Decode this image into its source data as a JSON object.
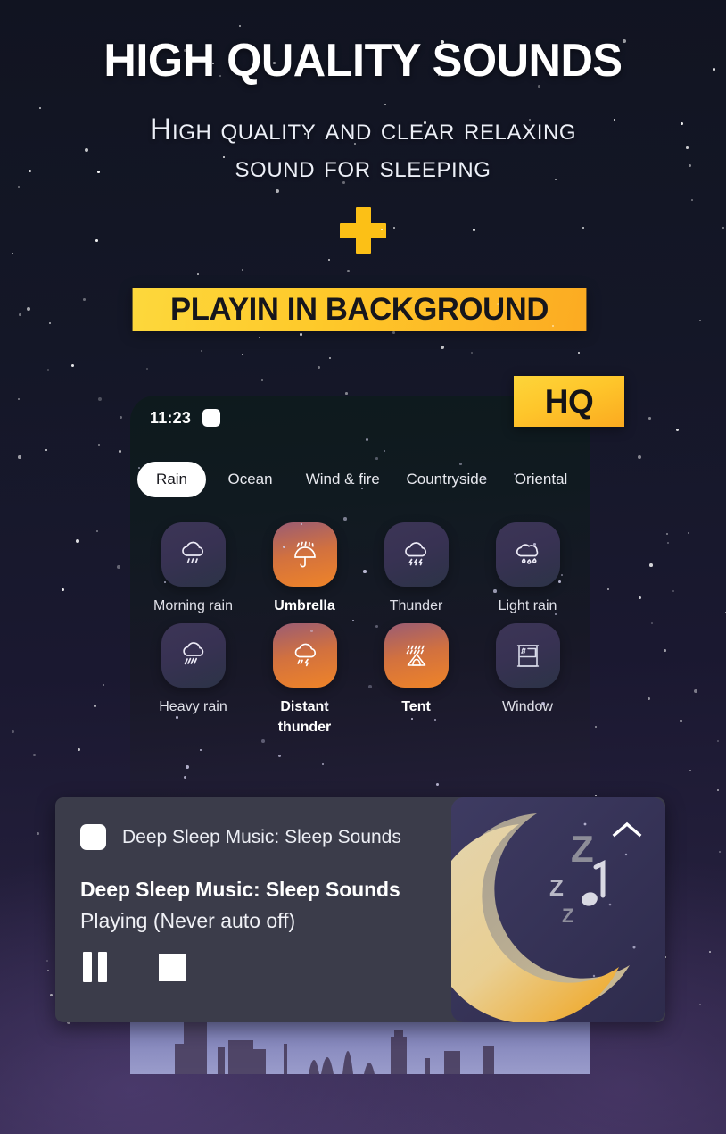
{
  "hero": {
    "title": "HIGH QUALITY SOUNDS",
    "subtitle_line1": "High quality and clear relaxing",
    "subtitle_line2": "sound for sleeping",
    "plus_icon": "plus-icon",
    "banner_label": "PLAYIN IN BACKGROUND",
    "hq_badge": "HQ"
  },
  "colors": {
    "accent_yellow": "#fec92a",
    "banner_text": "#16161c",
    "active_tile_orange": "#ef8428",
    "idle_tile_purple": "#383253",
    "notification_bg": "#3b3c4a"
  },
  "phone": {
    "statusbar": {
      "time": "11:23",
      "icon": "app-badge-icon"
    },
    "tabs": [
      {
        "label": "Rain",
        "active": true
      },
      {
        "label": "Ocean",
        "active": false
      },
      {
        "label": "Wind & fire",
        "active": false
      },
      {
        "label": "Countryside",
        "active": false
      },
      {
        "label": "Oriental",
        "active": false
      }
    ],
    "sounds": [
      {
        "label": "Morning rain",
        "icon": "cloud-rain-icon",
        "selected": false
      },
      {
        "label": "Umbrella",
        "icon": "umbrella-rain-icon",
        "selected": true
      },
      {
        "label": "Thunder",
        "icon": "cloud-lightning-icon",
        "selected": false
      },
      {
        "label": "Light rain",
        "icon": "cloud-drizzle-icon",
        "selected": false
      },
      {
        "label": "Heavy rain",
        "icon": "cloud-heavy-rain-icon",
        "selected": false
      },
      {
        "label": "Distant thunder",
        "icon": "cloud-thunder-icon",
        "selected": true
      },
      {
        "label": "Tent",
        "icon": "tent-rain-icon",
        "selected": true
      },
      {
        "label": "Window",
        "icon": "window-rain-icon",
        "selected": false
      }
    ]
  },
  "notification": {
    "app_icon": "app-icon",
    "app_name": "Deep Sleep Music: Sleep Sounds",
    "title": "Deep Sleep Music: Sleep Sounds",
    "status": "Playing (Never auto off)",
    "pause_button": "pause-icon",
    "stop_button": "stop-icon",
    "collapse_icon": "chevron-up-icon",
    "artwork": "crescent-moon-zzz-music-note-icon"
  }
}
